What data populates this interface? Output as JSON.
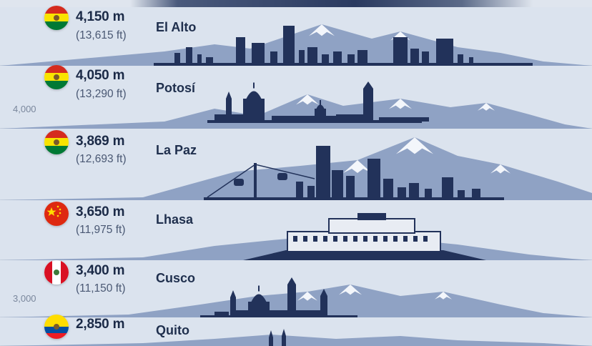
{
  "colors": {
    "skyline": "#22325a",
    "mountain": "#8fa2c4",
    "snow": "#f3f6fb",
    "band_sky": "#dbe3ee",
    "text_dark": "#1b2a47"
  },
  "chart_data": {
    "type": "bar",
    "categories": [
      "El Alto",
      "Potosí",
      "La Paz",
      "Lhasa",
      "Cusco",
      "Quito"
    ],
    "series": [
      {
        "values": [
          4150,
          4050,
          3869,
          3650,
          3400,
          2850
        ],
        "labels_m": [
          "4,150 m",
          "4,050 m",
          "3,869 m",
          "3,650 m",
          "3,400 m",
          "2,850 m"
        ],
        "labels_ft": [
          "(13,615 ft)",
          "(13,290 ft)",
          "(12,693 ft)",
          "(11,975 ft)",
          "(11,150 ft)",
          ""
        ]
      }
    ],
    "flags": [
      "bolivia",
      "bolivia",
      "bolivia",
      "china",
      "peru",
      "ecuador"
    ],
    "ytick_labels": [
      "4,000",
      "3,000"
    ]
  },
  "labels": {
    "cities": [
      "El Alto",
      "Potosí",
      "La Paz",
      "Lhasa",
      "Cusco",
      "Quito"
    ],
    "alt_m": [
      "4,150 m",
      "4,050 m",
      "3,869 m",
      "3,650 m",
      "3,400 m",
      "2,850 m"
    ],
    "alt_ft": [
      "(13,615 ft)",
      "(13,290 ft)",
      "(12,693 ft)",
      "(11,975 ft)",
      "(11,150 ft)",
      ""
    ],
    "ticks": [
      "4,000",
      "3,000"
    ]
  }
}
